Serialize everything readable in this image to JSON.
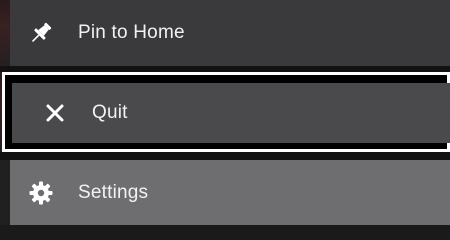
{
  "menu": {
    "items": [
      {
        "label": "Pin to Home",
        "icon": "pin-icon"
      },
      {
        "label": "Quit",
        "icon": "close-icon"
      },
      {
        "label": "Settings",
        "icon": "gear-icon"
      }
    ],
    "focused_index": 1
  }
}
